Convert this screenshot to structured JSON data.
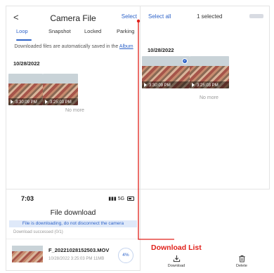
{
  "camera": {
    "back": "<",
    "title": "Camera File",
    "select": "Select",
    "tabs": [
      "Loop",
      "Snapshot",
      "Locked",
      "Parking"
    ],
    "notice_text": "Downloaded files are automatically saved in the",
    "notice_link": "Album",
    "date": "10/28/2022",
    "thumb_times": [
      "3:30:09 PM",
      "3:25:03 PM"
    ],
    "no_more": "No more"
  },
  "selection": {
    "select_all": "Select all",
    "selected": "1 selected",
    "date": "10/28/2022",
    "thumb_times": [
      "3:30:09 PM",
      "3:25:03 PM"
    ],
    "check": "✓",
    "no_more": "No more"
  },
  "download_screen": {
    "time": "7:03",
    "signal": "5G",
    "title": "File download",
    "banner": "File is downloading, do not disconnect the camera",
    "success": "Download successed (0/1)",
    "file_name": "F_20221028152503.MOV",
    "file_meta": "10/28/2022 3:25:03 PM 11MB",
    "progress": "4%"
  },
  "annotation": {
    "label": "Download List",
    "color": "#e0201a"
  },
  "bottom_bar": {
    "download": "Download",
    "delete": "Delete"
  },
  "colors": {
    "accent": "#2f64c9",
    "annotation_red": "#e0201a"
  }
}
